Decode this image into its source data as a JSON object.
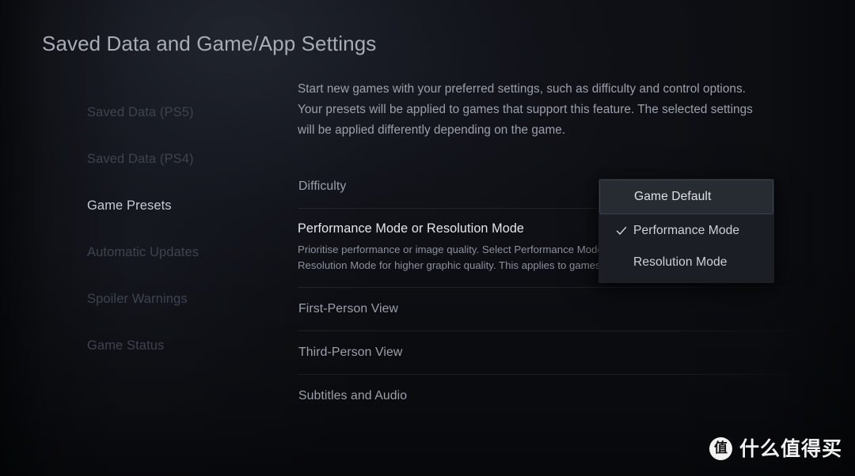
{
  "page": {
    "title": "Saved Data and Game/App Settings"
  },
  "sidebar": {
    "items": [
      {
        "label": "Saved Data (PS5)",
        "active": false
      },
      {
        "label": "Saved Data (PS4)",
        "active": false
      },
      {
        "label": "Game Presets",
        "active": true
      },
      {
        "label": "Automatic Updates",
        "active": false
      },
      {
        "label": "Spoiler Warnings",
        "active": false
      },
      {
        "label": "Game Status",
        "active": false
      }
    ]
  },
  "main": {
    "description": "Start new games with your preferred settings, such as difficulty and control options. Your presets will be applied to games that support this feature. The selected settings will be applied differently depending on the game.",
    "rows": [
      {
        "title": "Difficulty",
        "sub": "",
        "highlighted": false
      },
      {
        "title": "Performance Mode or Resolution Mode",
        "sub": "Prioritise performance or image quality. Select Performance Mode for smoother gameplay or Resolution Mode for higher graphic quality. This applies to games that support this feature.",
        "highlighted": true
      },
      {
        "title": "First-Person View",
        "sub": "",
        "highlighted": false
      },
      {
        "title": "Third-Person View",
        "sub": "",
        "highlighted": false
      },
      {
        "title": "Subtitles and Audio",
        "sub": "",
        "highlighted": false
      }
    ]
  },
  "dropdown": {
    "options": [
      {
        "label": "Game Default",
        "checked": false,
        "focused": true
      },
      {
        "label": "Performance Mode",
        "checked": true,
        "focused": false
      },
      {
        "label": "Resolution Mode",
        "checked": false,
        "focused": false
      }
    ]
  },
  "watermark": {
    "badge": "值",
    "text": "什么值得买"
  },
  "colors": {
    "background": "#0d0f14",
    "title": "#a7acb6",
    "sidebar_active": "#c6cad2",
    "sidebar_inactive": "#3e434e",
    "row_text": "#9ba0aa",
    "row_text_bright": "#e3e6ea",
    "dropdown_bg": "#1b1e24",
    "dropdown_focus_bg": "#272b32",
    "dropdown_focus_border": "#3d434d",
    "watermark": "#f2f2f2"
  }
}
